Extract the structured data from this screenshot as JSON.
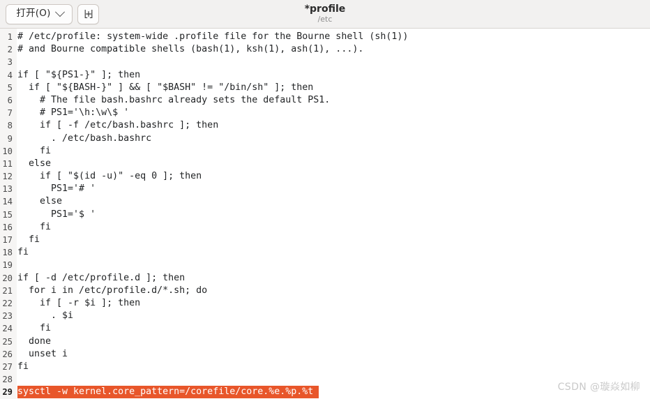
{
  "header": {
    "open_button_label": "打开(O)",
    "open_button_icon": "chevron-down-icon",
    "new_tab_button_icon": "new-tab-icon",
    "title": "*profile",
    "subtitle": "/etc"
  },
  "editor": {
    "current_line": 29,
    "highlight_color": "#e8562a",
    "highlight_text_color": "#ffffff",
    "gutter_color": "#f6f5f4",
    "background_color": "#ffffff",
    "text_color": "#222426",
    "lines": [
      {
        "n": "1",
        "text": "# /etc/profile: system-wide .profile file for the Bourne shell (sh(1))"
      },
      {
        "n": "2",
        "text": "# and Bourne compatible shells (bash(1), ksh(1), ash(1), ...)."
      },
      {
        "n": "3",
        "text": ""
      },
      {
        "n": "4",
        "text": "if [ \"${PS1-}\" ]; then"
      },
      {
        "n": "5",
        "text": "  if [ \"${BASH-}\" ] && [ \"$BASH\" != \"/bin/sh\" ]; then"
      },
      {
        "n": "6",
        "text": "    # The file bash.bashrc already sets the default PS1."
      },
      {
        "n": "7",
        "text": "    # PS1='\\h:\\w\\$ '"
      },
      {
        "n": "8",
        "text": "    if [ -f /etc/bash.bashrc ]; then"
      },
      {
        "n": "9",
        "text": "      . /etc/bash.bashrc"
      },
      {
        "n": "10",
        "text": "    fi"
      },
      {
        "n": "11",
        "text": "  else"
      },
      {
        "n": "12",
        "text": "    if [ \"$(id -u)\" -eq 0 ]; then"
      },
      {
        "n": "13",
        "text": "      PS1='# '"
      },
      {
        "n": "14",
        "text": "    else"
      },
      {
        "n": "15",
        "text": "      PS1='$ '"
      },
      {
        "n": "16",
        "text": "    fi"
      },
      {
        "n": "17",
        "text": "  fi"
      },
      {
        "n": "18",
        "text": "fi"
      },
      {
        "n": "19",
        "text": ""
      },
      {
        "n": "20",
        "text": "if [ -d /etc/profile.d ]; then"
      },
      {
        "n": "21",
        "text": "  for i in /etc/profile.d/*.sh; do"
      },
      {
        "n": "22",
        "text": "    if [ -r $i ]; then"
      },
      {
        "n": "23",
        "text": "      . $i"
      },
      {
        "n": "24",
        "text": "    fi"
      },
      {
        "n": "25",
        "text": "  done"
      },
      {
        "n": "26",
        "text": "  unset i"
      },
      {
        "n": "27",
        "text": "fi"
      },
      {
        "n": "28",
        "text": ""
      },
      {
        "n": "29",
        "text": "sysctl -w kernel.core_pattern=/corefile/core.%e.%p.%t"
      }
    ]
  },
  "watermark": {
    "text": "CSDN @璇焱如柳"
  }
}
